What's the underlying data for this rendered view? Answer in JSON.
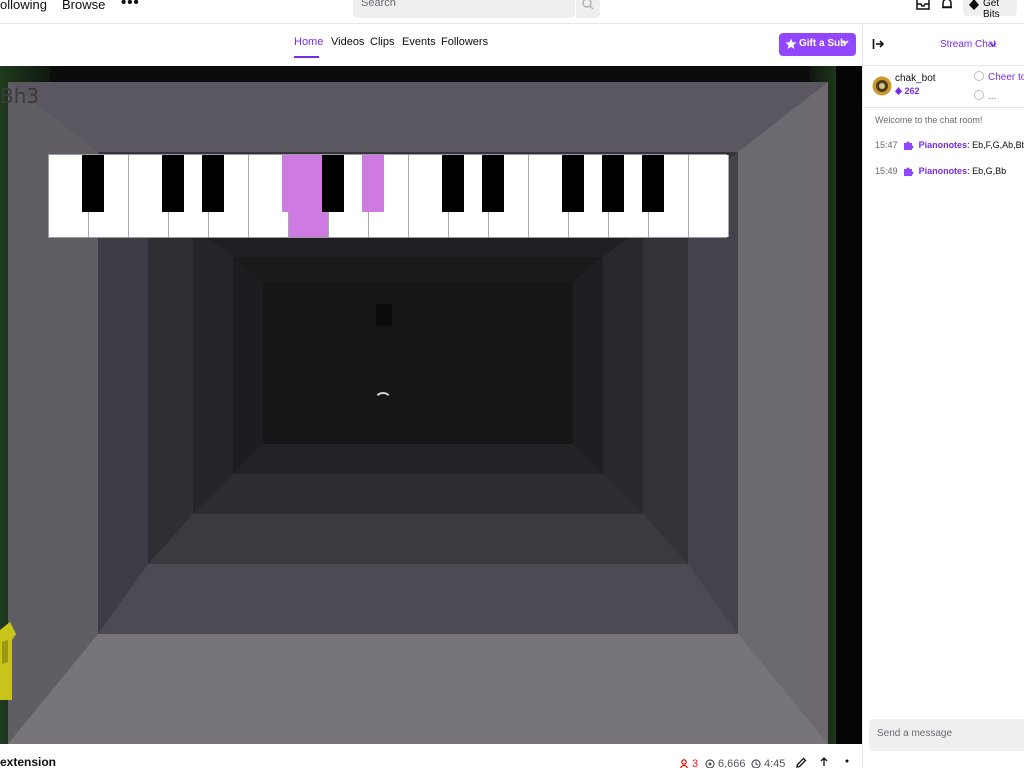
{
  "topnav": {
    "following": "ollowing",
    "browse": "Browse",
    "more": "•••",
    "search_placeholder": "Search",
    "get_bits": "Get Bits"
  },
  "tabs": {
    "home": "Home",
    "videos": "Videos",
    "clips": "Clips",
    "events": "Events",
    "followers": "Followers",
    "gift_sub": "Gift a Sub"
  },
  "player": {
    "overlay_text": "Bh3",
    "piano": {
      "highlighted_white_key_indices": [
        6
      ],
      "highlighted_black_key_indices": [
        3,
        5
      ],
      "colors": {
        "highlight": "#cf79e2",
        "white": "#ffffff",
        "black": "#000000"
      }
    }
  },
  "info": {
    "title": "extension",
    "viewers": "3",
    "views": "6,666",
    "uptime": "4:45"
  },
  "chat": {
    "title": "Stream Chat",
    "leader_name": "chak_bot",
    "leader_bits": "262",
    "cheer_1": "Cheer to ta",
    "cheer_2": "...",
    "welcome": "Welcome to the chat room!",
    "messages": [
      {
        "time": "15:47",
        "user": "Pianonotes",
        "text": ": Eb,F,G,Ab,Bb,C,D,Eb"
      },
      {
        "time": "15:49",
        "user": "Pianonotes",
        "text": ": Eb,G,Bb"
      }
    ],
    "input_placeholder": "Send a message"
  },
  "colors": {
    "accent": "#9147ff",
    "accent_text": "#772ce8",
    "live_red": "#e91916"
  }
}
